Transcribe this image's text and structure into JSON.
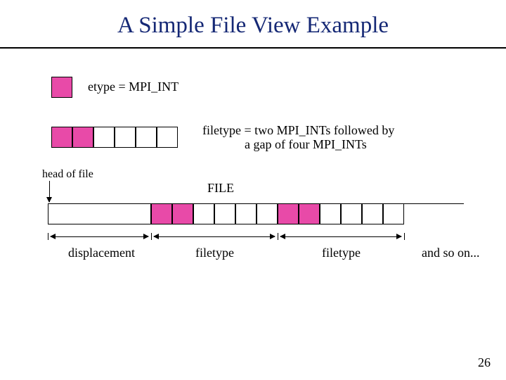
{
  "title": "A Simple File View Example",
  "labels": {
    "etype": "etype = MPI_INT",
    "filetype_desc_l1": "filetype = two MPI_INTs followed by ",
    "filetype_desc_l2": "a gap of four MPI_INTs",
    "head": "head of file",
    "file": "FILE",
    "displacement": "displacement",
    "filetype1": "filetype",
    "filetype2": "filetype",
    "and_so_on": "and so on..."
  },
  "page": "26"
}
